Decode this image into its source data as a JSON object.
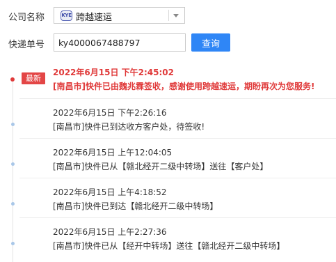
{
  "form": {
    "company_label": "公司名称",
    "company_logo_text": "KYE",
    "company_value": "跨越速运",
    "tracking_label": "快递单号",
    "tracking_value": "ky4000067488797",
    "query_button": "查询"
  },
  "timeline": {
    "latest_badge": "最新",
    "events": [
      {
        "time": "2022年6月15日 下午2:45:02",
        "desc": "[南昌市]快件已由魏兆霖签收，感谢使用跨越速运，期盼再次为您服务!"
      },
      {
        "time": "2022年6月15日 下午2:26:16",
        "desc": "[南昌市]快件已到达收方客户处，待签收!"
      },
      {
        "time": "2022年6月15日 上午12:04:05",
        "desc": "[南昌市]快件已从【赣北经开二级中转场】送往【客户处】"
      },
      {
        "time": "2022年6月15日 上午4:18:52",
        "desc": "[南昌市]快件已到达【赣北经开二级中转场】"
      },
      {
        "time": "2022年6月15日 上午2:27:36",
        "desc": "[南昌市]快件已从【经开中转场】送往【赣北经开二级中转场】"
      }
    ]
  },
  "colors": {
    "accent": "#2f86f6",
    "latest": "#e03a3a",
    "dot": "#a9c7e8"
  }
}
